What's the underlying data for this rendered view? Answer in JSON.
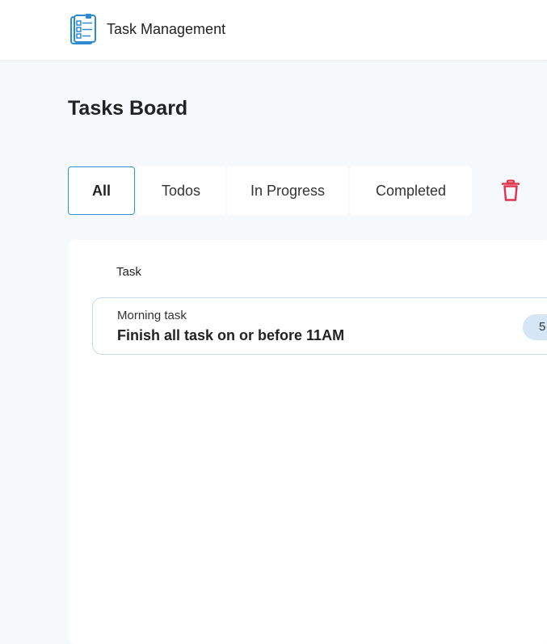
{
  "header": {
    "app_title": "Task Management",
    "logo_icon": "clipboard-checklist-icon"
  },
  "page": {
    "title": "Tasks Board"
  },
  "tabs": [
    {
      "label": "All",
      "active": true
    },
    {
      "label": "Todos",
      "active": false
    },
    {
      "label": "In Progress",
      "active": false
    },
    {
      "label": "Completed",
      "active": false
    }
  ],
  "toolbar": {
    "delete_icon": "trash-icon",
    "delete_color": "#e0344e"
  },
  "board": {
    "column_header": "Task",
    "tasks": [
      {
        "subtitle": "Morning task",
        "title": "Finish all task on or before 11AM",
        "badge": "5"
      }
    ]
  },
  "colors": {
    "accent": "#3a8fd0",
    "background": "#f5f9fc",
    "badge_bg": "#d5e6f4"
  }
}
